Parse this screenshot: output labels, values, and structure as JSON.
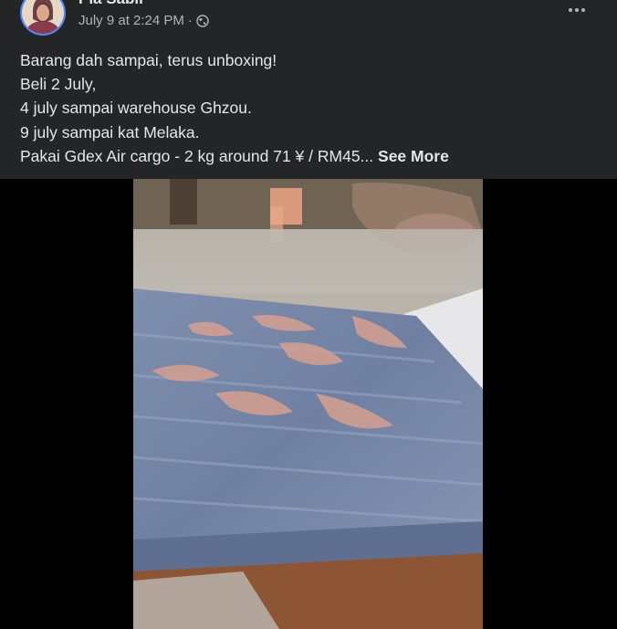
{
  "post": {
    "author": "Pia Sabil",
    "timestamp": "July 9 at 2:24 PM",
    "separator": "·",
    "audience_icon": "globe-icon",
    "more_icon": "more-horizontal-icon",
    "text_lines": [
      "Barang dah sampai, terus unboxing!",
      "Beli 2 July,",
      "4 july sampai warehouse Ghzou.",
      "9 july sampai kat Melaka.",
      "Pakai Gdex Air cargo - 2 kg around 71 ¥ / RM45..."
    ],
    "see_more_label": "See More"
  },
  "media": {
    "type": "video",
    "icon": "video-thumbnail"
  },
  "colors": {
    "background": "#242526",
    "text_primary": "#e4e6eb",
    "text_secondary": "#b0b3b8",
    "media_letterbox": "#000000"
  }
}
